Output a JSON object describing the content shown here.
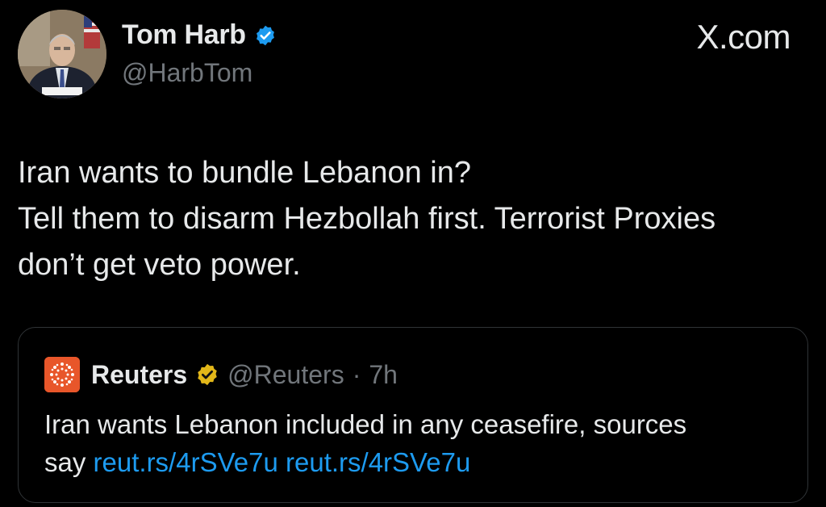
{
  "author": {
    "display_name": "Tom Harb",
    "handle": "@HarbTom",
    "verified_icon": "blue-verified-badge-icon",
    "avatar": "profile-photo"
  },
  "watermark": {
    "label": "X.com"
  },
  "tweet": {
    "lines": [
      "Iran wants to bundle Lebanon in?",
      "Tell them to disarm Hezbollah first. Terrorist Proxies",
      "don’t get veto power."
    ]
  },
  "quoted_tweet": {
    "logo": "reuters-logo-icon",
    "display_name": "Reuters",
    "verified_icon": "gold-verified-badge-icon",
    "handle": "@Reuters",
    "separator": "·",
    "time": "7h",
    "text_line1": "Iran wants Lebanon included in any ceasefire, sources",
    "text_line2_prefix": "say",
    "links": [
      "reut.rs/4rSVe7u",
      "reut.rs/4rSVe7u"
    ]
  },
  "colors": {
    "background": "#000000",
    "text": "#e7e9ea",
    "muted": "#71767b",
    "link": "#1d9bf0",
    "verified_blue": "#1d9bf0",
    "verified_gold": "#e2b719",
    "reuters_orange": "#e8562a",
    "border": "#2f3336"
  }
}
